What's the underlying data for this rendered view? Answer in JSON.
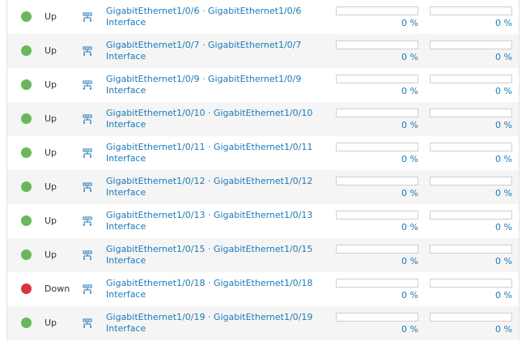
{
  "rows": [
    {
      "status": "Up",
      "status_color": "#6ab75b",
      "name": "GigabitEthernet1/0/6 · GigabitEthernet1/0/6",
      "type": "Interface",
      "rx_pct": "0 %",
      "tx_pct": "0 %",
      "rx_value": 0,
      "tx_value": 0
    },
    {
      "status": "Up",
      "status_color": "#6ab75b",
      "name": "GigabitEthernet1/0/7 · GigabitEthernet1/0/7",
      "type": "Interface",
      "rx_pct": "0 %",
      "tx_pct": "0 %",
      "rx_value": 0,
      "tx_value": 0
    },
    {
      "status": "Up",
      "status_color": "#6ab75b",
      "name": "GigabitEthernet1/0/9 · GigabitEthernet1/0/9",
      "type": "Interface",
      "rx_pct": "0 %",
      "tx_pct": "0 %",
      "rx_value": 0,
      "tx_value": 0
    },
    {
      "status": "Up",
      "status_color": "#6ab75b",
      "name": "GigabitEthernet1/0/10 · GigabitEthernet1/0/10",
      "type": "Interface",
      "rx_pct": "0 %",
      "tx_pct": "0 %",
      "rx_value": 0,
      "tx_value": 0
    },
    {
      "status": "Up",
      "status_color": "#6ab75b",
      "name": "GigabitEthernet1/0/11 · GigabitEthernet1/0/11",
      "type": "Interface",
      "rx_pct": "0 %",
      "tx_pct": "0 %",
      "rx_value": 0,
      "tx_value": 0
    },
    {
      "status": "Up",
      "status_color": "#6ab75b",
      "name": "GigabitEthernet1/0/12 · GigabitEthernet1/0/12",
      "type": "Interface",
      "rx_pct": "0 %",
      "tx_pct": "0 %",
      "rx_value": 0,
      "tx_value": 0
    },
    {
      "status": "Up",
      "status_color": "#6ab75b",
      "name": "GigabitEthernet1/0/13 · GigabitEthernet1/0/13",
      "type": "Interface",
      "rx_pct": "0 %",
      "tx_pct": "0 %",
      "rx_value": 0,
      "tx_value": 0
    },
    {
      "status": "Up",
      "status_color": "#6ab75b",
      "name": "GigabitEthernet1/0/15 · GigabitEthernet1/0/15",
      "type": "Interface",
      "rx_pct": "0 %",
      "tx_pct": "0 %",
      "rx_value": 0,
      "tx_value": 0
    },
    {
      "status": "Down",
      "status_color": "#d8353f",
      "name": "GigabitEthernet1/0/18 · GigabitEthernet1/0/18",
      "type": "Interface",
      "rx_pct": "0 %",
      "tx_pct": "0 %",
      "rx_value": 0,
      "tx_value": 0
    },
    {
      "status": "Up",
      "status_color": "#6ab75b",
      "name": "GigabitEthernet1/0/19 · GigabitEthernet1/0/19",
      "type": "Interface",
      "rx_pct": "0 %",
      "tx_pct": "0 %",
      "rx_value": 0,
      "tx_value": 0
    }
  ],
  "icon": "network-interface-icon",
  "link_color": "#1c7ab8"
}
